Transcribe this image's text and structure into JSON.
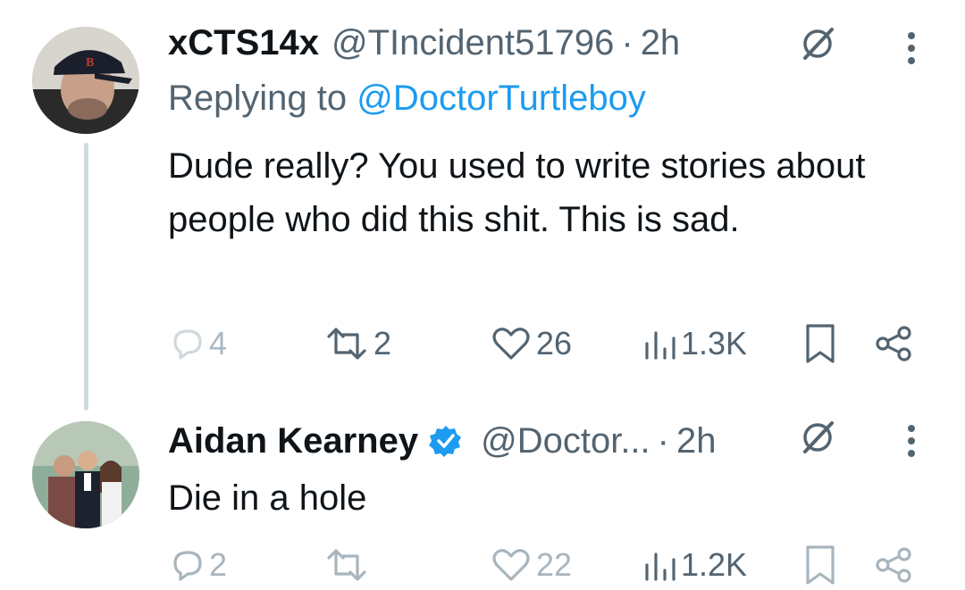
{
  "tweets": [
    {
      "display_name": "xCTS14x",
      "handle": "@TIncident51796",
      "separator": "·",
      "time": "2h",
      "replying_prefix": "Replying to",
      "replying_handle": "@DoctorTurtleboy",
      "text": "Dude really? You used to write stories about people who did this shit. This is sad.",
      "replies": "4",
      "retweets": "2",
      "likes": "26",
      "views": "1.3K",
      "verified": false
    },
    {
      "display_name": "Aidan Kearney",
      "handle": "@Doctor...",
      "separator": "·",
      "time": "2h",
      "text": "Die in a hole",
      "replies": "2",
      "retweets": "",
      "likes": "22",
      "views": "1.2K",
      "verified": true
    }
  ],
  "colors": {
    "text": "#0f1419",
    "secondary": "#536471",
    "link": "#1d9bf0",
    "verified_badge": "#1d9bf0",
    "thread_line": "#cfd9de"
  },
  "icons": [
    "reply-icon",
    "retweet-icon",
    "like-icon",
    "views-icon",
    "bookmark-icon",
    "share-icon",
    "grok-icon",
    "more-icon",
    "verified-badge-icon"
  ]
}
